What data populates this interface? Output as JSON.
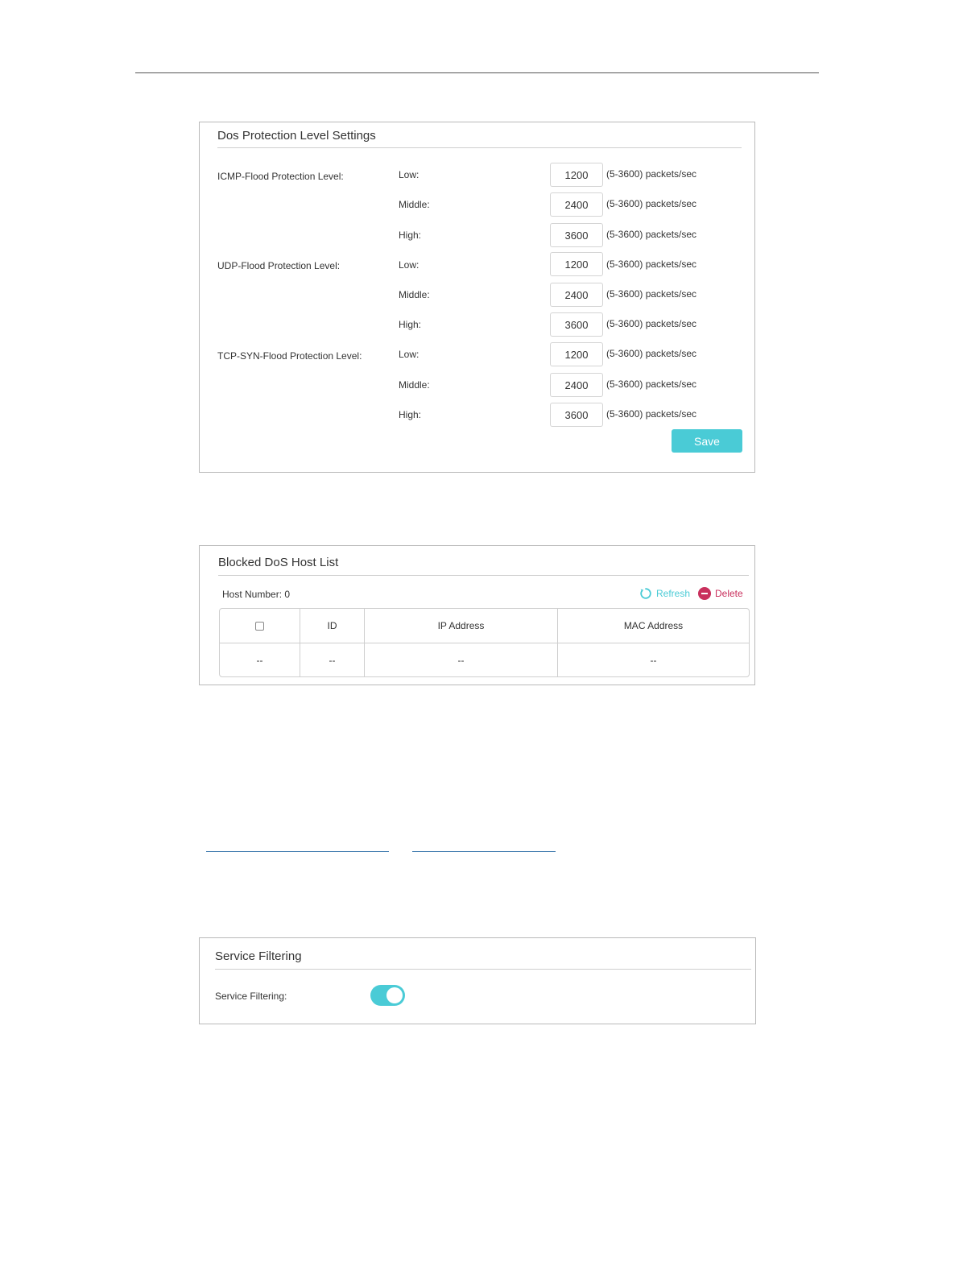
{
  "dos": {
    "title": "Dos Protection Level Settings",
    "groups": [
      {
        "label": "ICMP-Flood Protection Level:",
        "levels": [
          {
            "label": "Low:",
            "value": "1200",
            "note": "(5-3600) packets/sec"
          },
          {
            "label": "Middle:",
            "value": "2400",
            "note": "(5-3600) packets/sec"
          },
          {
            "label": "High:",
            "value": "3600",
            "note": "(5-3600) packets/sec"
          }
        ]
      },
      {
        "label": "UDP-Flood Protection Level:",
        "levels": [
          {
            "label": "Low:",
            "value": "1200",
            "note": "(5-3600) packets/sec"
          },
          {
            "label": "Middle:",
            "value": "2400",
            "note": "(5-3600) packets/sec"
          },
          {
            "label": "High:",
            "value": "3600",
            "note": "(5-3600) packets/sec"
          }
        ]
      },
      {
        "label": "TCP-SYN-Flood Protection Level:",
        "levels": [
          {
            "label": "Low:",
            "value": "1200",
            "note": "(5-3600) packets/sec"
          },
          {
            "label": "Middle:",
            "value": "2400",
            "note": "(5-3600) packets/sec"
          },
          {
            "label": "High:",
            "value": "3600",
            "note": "(5-3600) packets/sec"
          }
        ]
      }
    ],
    "save_label": "Save"
  },
  "blocked": {
    "title": "Blocked DoS Host List",
    "host_number": "Host Number: 0",
    "refresh_label": "Refresh",
    "delete_label": "Delete",
    "columns": [
      "ID",
      "IP Address",
      "MAC Address"
    ],
    "rows": [
      {
        "check": "--",
        "id": "--",
        "ip": "--",
        "mac": "--"
      }
    ]
  },
  "service": {
    "title": "Service Filtering",
    "label": "Service Filtering:",
    "enabled": true
  },
  "colors": {
    "accent": "#4acbd6",
    "delete": "#c9305d",
    "link": "#2f6fa7"
  }
}
